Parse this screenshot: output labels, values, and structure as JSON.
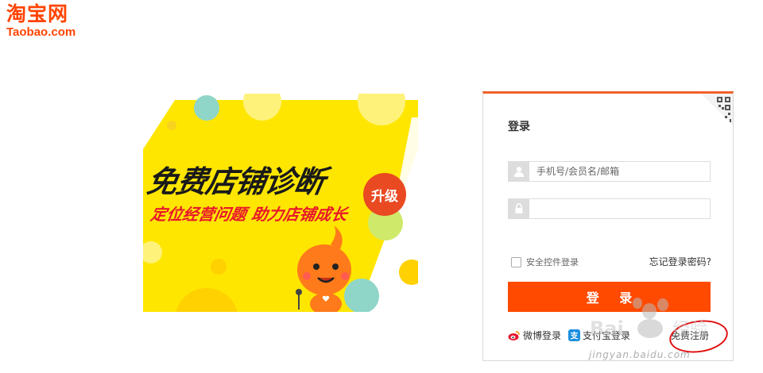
{
  "logo": {
    "name_cn": "淘宝网",
    "domain": "Taobao.com"
  },
  "banner": {
    "title": "免费店铺诊断",
    "subtitle": "定位经营问题 助力店铺成长",
    "badge": "升级"
  },
  "login": {
    "title": "登录",
    "username_placeholder": "手机号/会员名/邮箱",
    "password_placeholder": "",
    "safe_control_label": "安全控件登录",
    "forgot_password": "忘记登录密码?",
    "submit_label": "登 录",
    "weibo_login": "微博登录",
    "alipay_login": "支付宝登录",
    "register": "免费注册"
  },
  "watermark": {
    "text": "jingyan.baidu.com"
  },
  "colors": {
    "brand": "#ff4400",
    "accent": "#ff4a00",
    "banner_yellow": "#ffe600"
  },
  "icons": [
    "user-icon",
    "lock-icon",
    "qrcode-icon",
    "weibo-icon",
    "alipay-icon",
    "checkbox-icon"
  ]
}
